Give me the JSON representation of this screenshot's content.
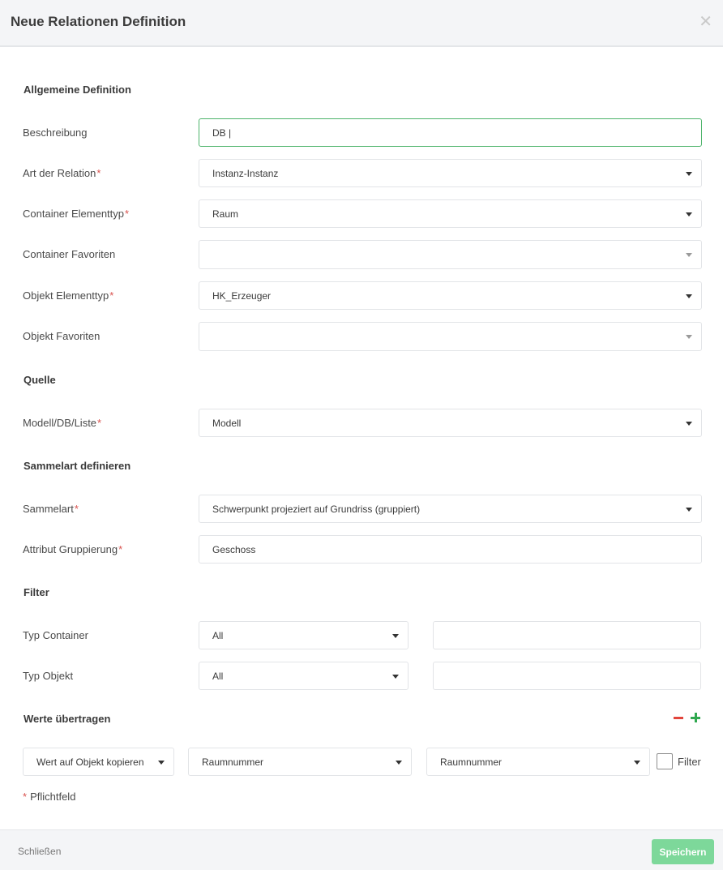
{
  "dialog": {
    "title": "Neue Relationen Definition",
    "close_glyph": "✕"
  },
  "sections": {
    "general": "Allgemeine Definition",
    "source": "Quelle",
    "collect": "Sammelart definieren",
    "filter": "Filter",
    "transfer": "Werte übertragen"
  },
  "required_marker": "*",
  "fields": {
    "description": {
      "label": "Beschreibung",
      "value": "DB |"
    },
    "relation_type": {
      "label": "Art der Relation",
      "value": "Instanz-Instanz"
    },
    "container_type": {
      "label": "Container Elementtyp",
      "value": "Raum"
    },
    "container_favorites": {
      "label": "Container Favoriten",
      "value": ""
    },
    "object_type": {
      "label": "Objekt Elementtyp",
      "value": "HK_Erzeuger"
    },
    "object_favorites": {
      "label": "Objekt Favoriten",
      "value": ""
    },
    "source": {
      "label": "Modell/DB/Liste",
      "value": "Modell"
    },
    "collect_type": {
      "label": "Sammelart",
      "value": "Schwerpunkt projeziert auf Grundriss (gruppiert)"
    },
    "group_attribute": {
      "label": "Attribut Gruppierung",
      "value": "Geschoss"
    },
    "filter_container": {
      "label": "Typ Container",
      "value": "All",
      "text": ""
    },
    "filter_object": {
      "label": "Typ Objekt",
      "value": "All",
      "text": ""
    }
  },
  "transfer": {
    "mode": "Wert auf Objekt kopieren",
    "source_attr": "Raumnummer",
    "target_attr": "Raumnummer",
    "filter_label": "Filter",
    "filter_checked": false
  },
  "footnote": "Pflichtfeld",
  "footer": {
    "close_label": "Schließen",
    "save_label": "Speichern"
  },
  "colors": {
    "accent_green": "#4cb36a",
    "save_button": "#7dd89a",
    "required_red": "#d9534f",
    "minus_red": "#e2453c",
    "plus_green": "#2fa84f"
  },
  "icons": {
    "close": "close-icon",
    "caret": "caret-down-icon",
    "remove": "minus-icon",
    "add": "plus-icon"
  }
}
